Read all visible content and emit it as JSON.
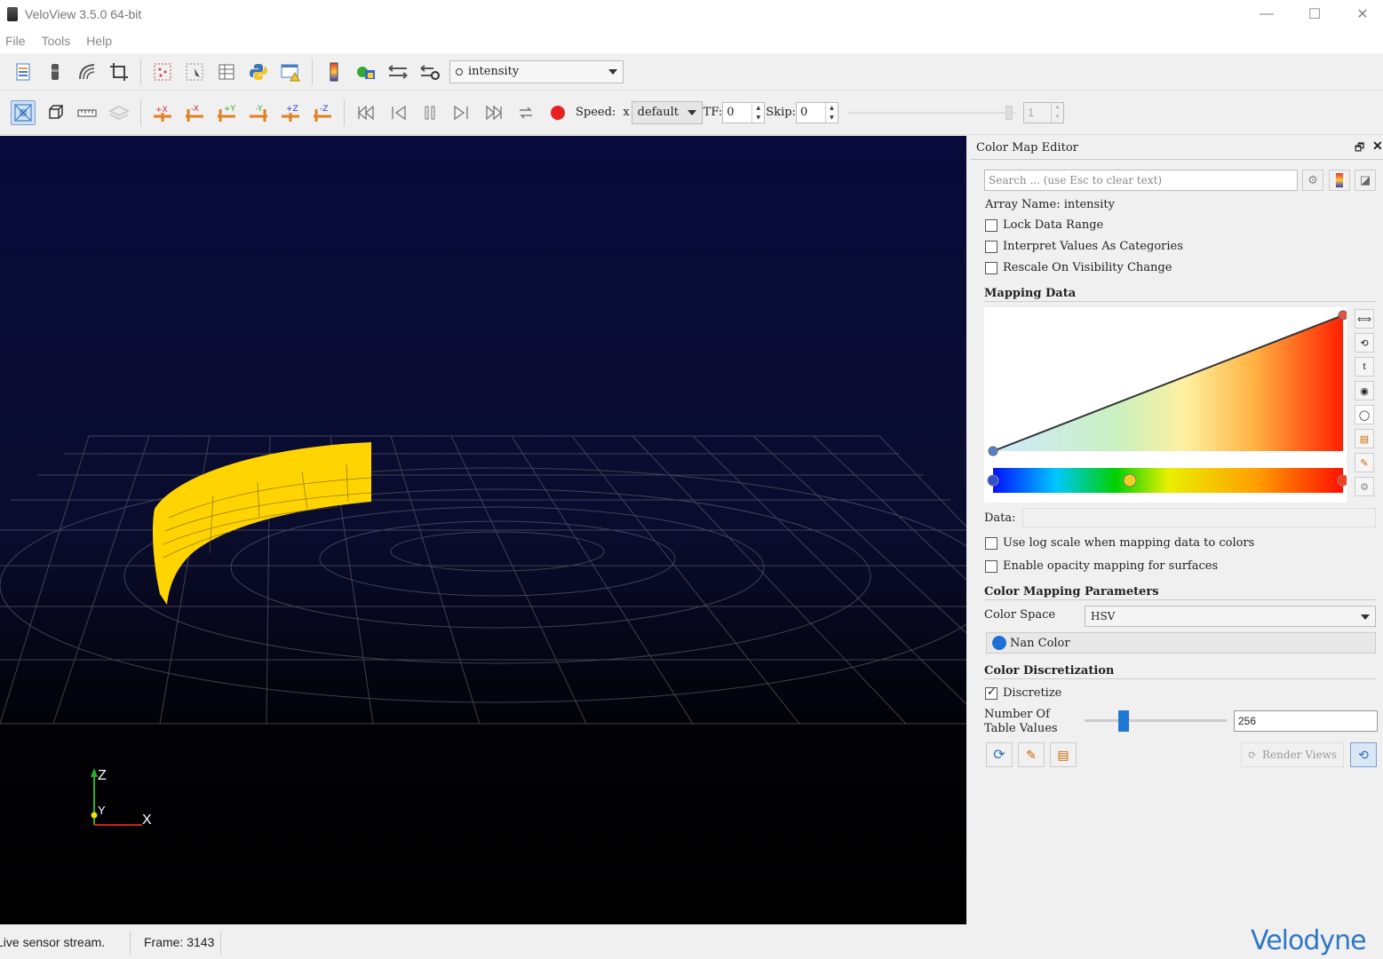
{
  "window": {
    "title": "VeloView 3.5.0 64-bit",
    "minimize": "—",
    "maximize": "☐",
    "close": "✕"
  },
  "menu": [
    "File",
    "Tools",
    "Help"
  ],
  "toolbar1": {
    "array_combo": "intensity",
    "array_combo_icon": "point-data-icon"
  },
  "toolbar2": {
    "speed_label": "Speed:",
    "speed_prefix": "x",
    "speed_value": "default",
    "tf_label": "TF:",
    "tf_value": "0",
    "skip_label": "Skip:",
    "skip_value": "0",
    "frame_spin_value": "1"
  },
  "viewport": {
    "axis_z": "Z",
    "axis_y": "Y",
    "axis_x": "X",
    "background_top": "#070a3a",
    "surface_color": "#ffd400",
    "grid_color": "#5a5a66"
  },
  "color_map_editor": {
    "title": "Color Map Editor",
    "search_placeholder": "Search ... (use Esc to clear text)",
    "array_name_label": "Array Name: intensity",
    "lock_data_range": "Lock Data Range",
    "interpret_categories": "Interpret Values As Categories",
    "rescale_visibility": "Rescale On Visibility Change",
    "mapping_data": "Mapping Data",
    "data_label": "Data:",
    "data_value": "",
    "use_log_scale": "Use log scale when mapping data to colors",
    "enable_opacity": "Enable opacity mapping for surfaces",
    "color_mapping_params": "Color Mapping Parameters",
    "color_space_label": "Color Space",
    "color_space_value": "HSV",
    "nan_color_label": "Nan Color",
    "nan_color": "#1e6fd6",
    "color_discretization": "Color Discretization",
    "discretize": "Discretize",
    "discretize_checked": true,
    "number_of_table_values_label": "Number Of Table Values",
    "number_of_table_values": "256",
    "slider_level_percent": 26,
    "render_views": "Render Views"
  },
  "status": {
    "stream_text": "Live sensor stream.",
    "frame_text": "Frame: 3143",
    "brand": "Velodyne"
  }
}
